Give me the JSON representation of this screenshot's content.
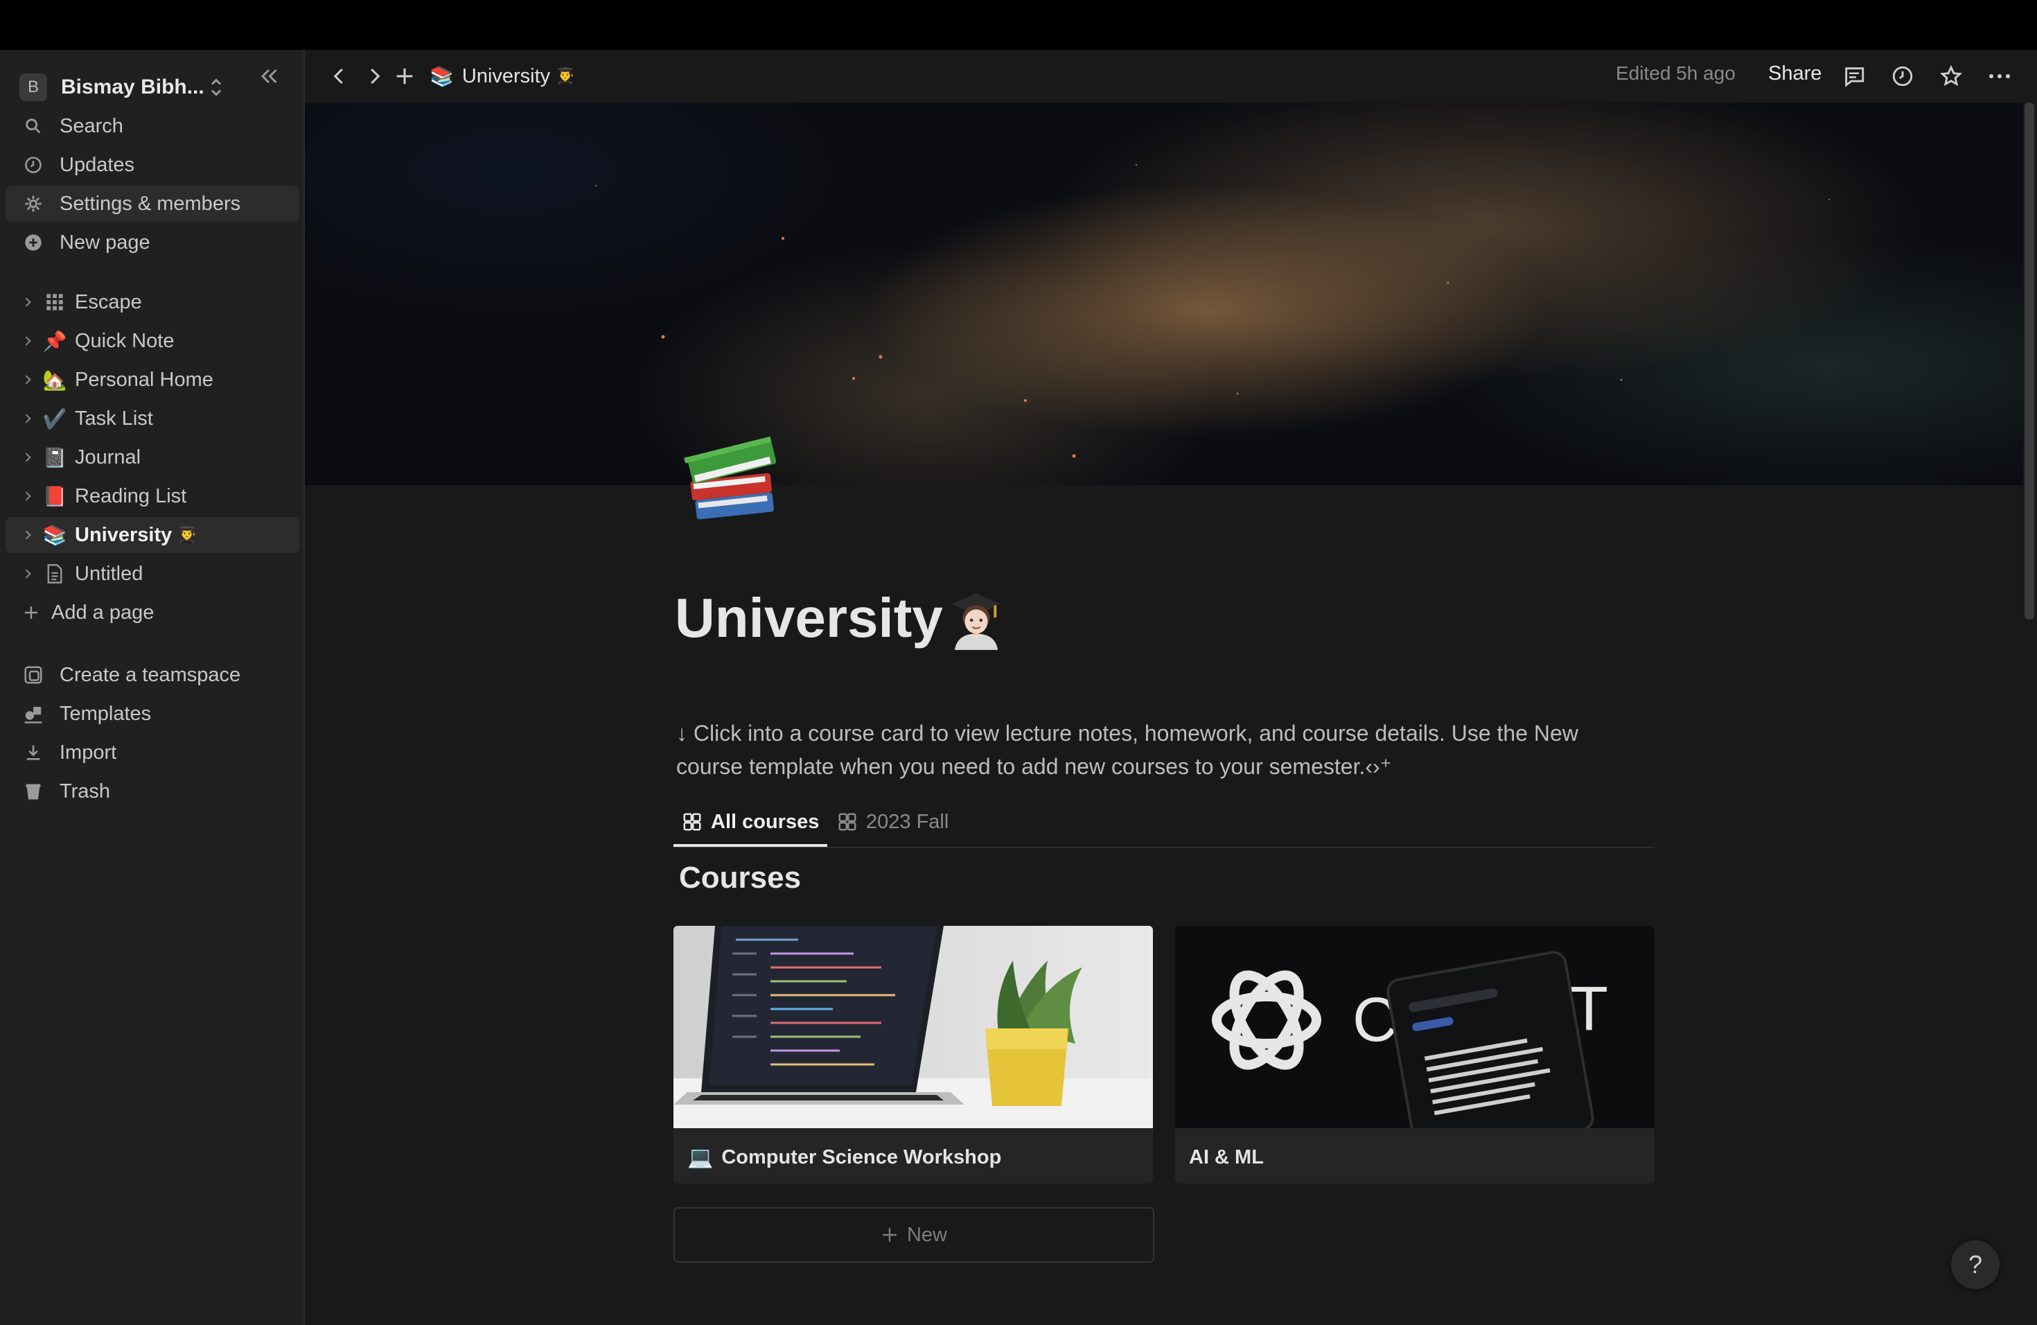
{
  "workspace": {
    "initial": "B",
    "name": "Bismay Bibh..."
  },
  "sidebar": {
    "nav": [
      {
        "label": "Search",
        "icon": "search-icon"
      },
      {
        "label": "Updates",
        "icon": "clock-icon"
      },
      {
        "label": "Settings & members",
        "icon": "gear-icon"
      },
      {
        "label": "New page",
        "icon": "plus-circle-icon"
      }
    ],
    "pages": [
      {
        "label": "Escape",
        "emoji": "grid-icon"
      },
      {
        "label": "Quick Note",
        "emoji": "📌"
      },
      {
        "label": "Personal Home",
        "emoji": "🏡"
      },
      {
        "label": "Task List",
        "emoji": "✔️"
      },
      {
        "label": "Journal",
        "emoji": "📓"
      },
      {
        "label": "Reading List",
        "emoji": "📕"
      },
      {
        "label": "University",
        "emoji": "📚",
        "suffix": "👨‍🎓"
      },
      {
        "label": "Untitled",
        "emoji": "page-icon"
      }
    ],
    "add_page": "Add a page",
    "footer": [
      {
        "label": "Create a teamspace",
        "icon": "teamspace-icon"
      },
      {
        "label": "Templates",
        "icon": "templates-icon"
      },
      {
        "label": "Import",
        "icon": "download-icon"
      },
      {
        "label": "Trash",
        "icon": "trash-icon"
      }
    ]
  },
  "header": {
    "breadcrumb": "University",
    "breadcrumb_emoji": "📚",
    "breadcrumb_suffix": "👨‍🎓",
    "edited": "Edited 5h ago",
    "share": "Share"
  },
  "page": {
    "icon": "📚",
    "title": "University",
    "title_emoji": "👨🏻‍🎓",
    "description": "↓ Click into a course card to view lecture notes, homework, and course details. Use the New course template when you need to add new courses to your semester.‹›⁺",
    "tabs": [
      {
        "label": "All courses",
        "active": true
      },
      {
        "label": "2023 Fall",
        "active": false
      }
    ],
    "section_title": "Courses",
    "cards": [
      {
        "title": "Computer Science Workshop",
        "emoji": "💻"
      },
      {
        "title": "AI & ML",
        "emoji": ""
      }
    ],
    "new_label": "New",
    "help": "?"
  },
  "colors": {
    "background": "#191919",
    "sidebar": "#202020",
    "text": "#d4d4d4",
    "muted": "#8a8a8a"
  }
}
